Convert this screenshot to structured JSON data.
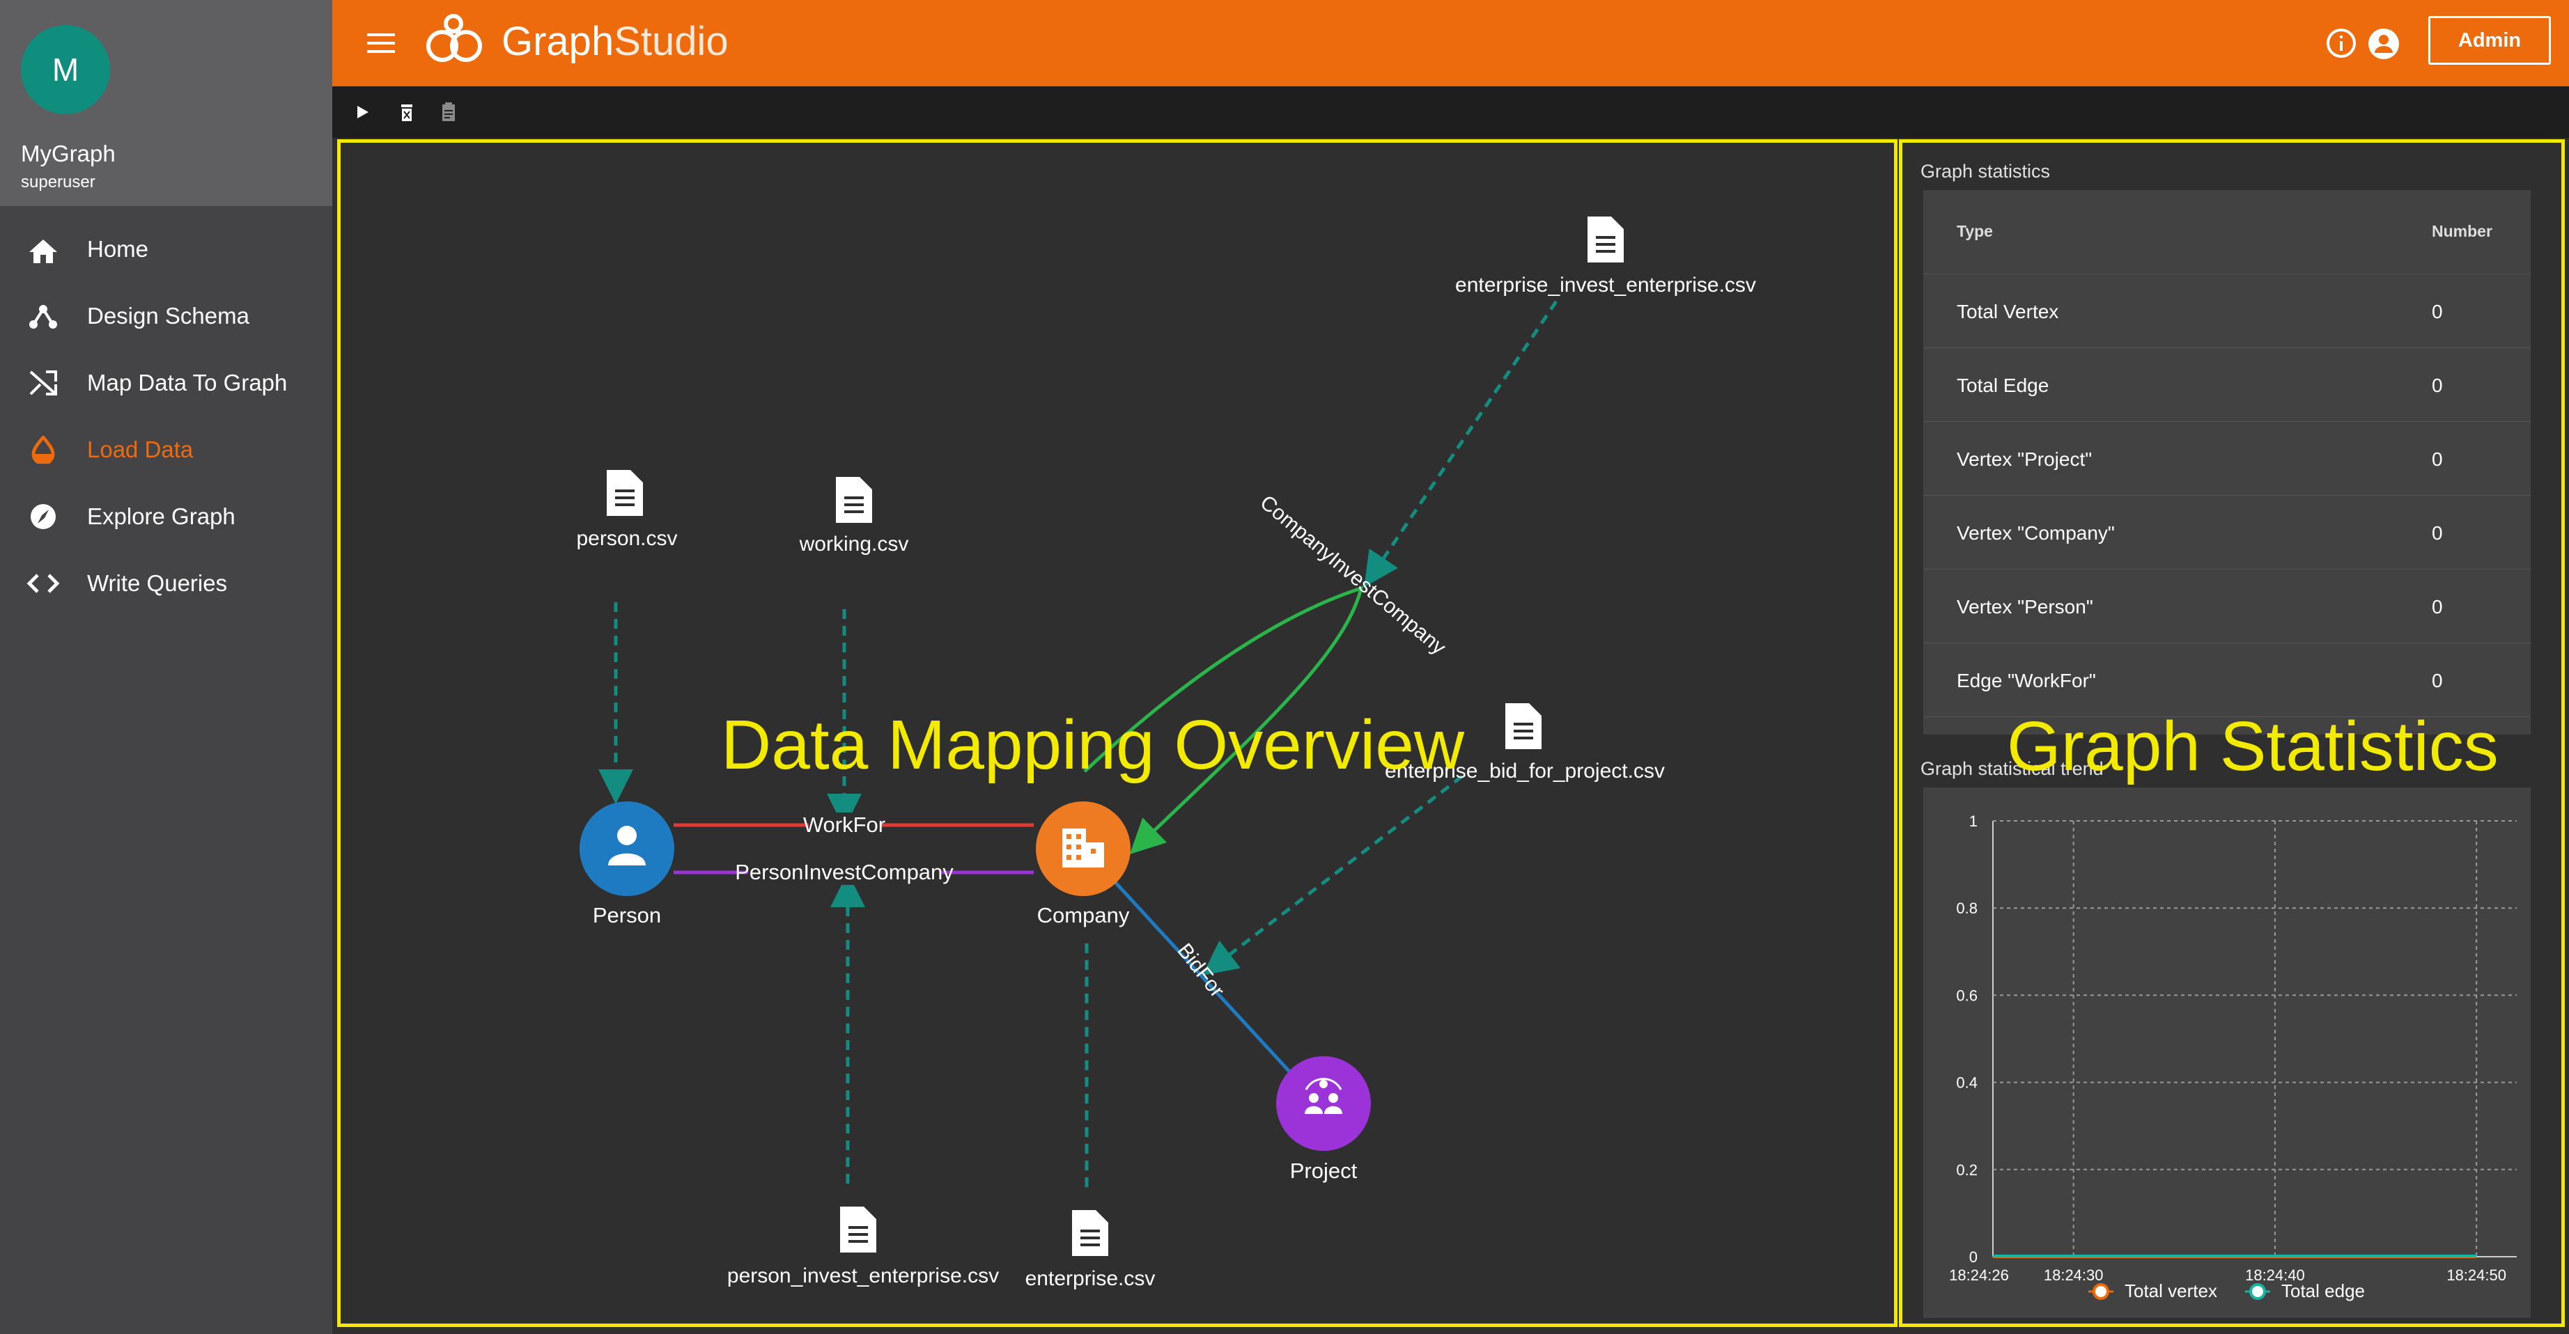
{
  "user": {
    "avatar_letter": "M",
    "name": "MyGraph",
    "role": "superuser"
  },
  "nav": [
    {
      "label": "Home",
      "icon": "home-icon",
      "active": false
    },
    {
      "label": "Design Schema",
      "icon": "schema-icon",
      "active": false
    },
    {
      "label": "Map Data To Graph",
      "icon": "shuffle-icon",
      "active": false
    },
    {
      "label": "Load Data",
      "icon": "drop-icon",
      "active": true
    },
    {
      "label": "Explore Graph",
      "icon": "compass-icon",
      "active": false
    },
    {
      "label": "Write Queries",
      "icon": "code-icon",
      "active": false
    }
  ],
  "header": {
    "title_part1": "Graph",
    "title_part2": "Studio",
    "admin_label": "Admin"
  },
  "colors": {
    "accent": "#ed6b0c",
    "highlight": "#f2ea00",
    "person": "#1f7bc1",
    "company": "#ee7b22",
    "project": "#9b33d9",
    "dashed": "#138d7f"
  },
  "overlays": {
    "overview": "Data Mapping Overview",
    "stats": "Graph Statistics"
  },
  "graph": {
    "vertices": [
      {
        "id": "person",
        "label": "Person"
      },
      {
        "id": "company",
        "label": "Company"
      },
      {
        "id": "project",
        "label": "Project"
      }
    ],
    "edges": [
      {
        "label": "WorkFor"
      },
      {
        "label": "PersonInvestCompany"
      },
      {
        "label": "CompanyInvestCompany"
      },
      {
        "label": "BidFor"
      }
    ],
    "files": [
      "person.csv",
      "working.csv",
      "enterprise_invest_enterprise.csv",
      "enterprise_bid_for_project.csv",
      "person_invest_enterprise.csv",
      "enterprise.csv"
    ]
  },
  "stats": {
    "title": "Graph statistics",
    "col_type": "Type",
    "col_number": "Number",
    "rows": [
      {
        "type": "Total Vertex",
        "number": "0"
      },
      {
        "type": "Total Edge",
        "number": "0"
      },
      {
        "type": "Vertex \"Project\"",
        "number": "0"
      },
      {
        "type": "Vertex \"Company\"",
        "number": "0"
      },
      {
        "type": "Vertex \"Person\"",
        "number": "0"
      },
      {
        "type": "Edge \"WorkFor\"",
        "number": "0"
      }
    ]
  },
  "trend": {
    "title": "Graph statistical trend"
  },
  "chart_data": {
    "type": "line",
    "title": "Graph statistical trend",
    "x": [
      "18:24:26",
      "18:24:30",
      "18:24:40",
      "18:24:50"
    ],
    "series": [
      {
        "name": "Total vertex",
        "values": [
          0,
          0,
          0,
          0
        ]
      },
      {
        "name": "Total edge",
        "values": [
          0,
          0,
          0,
          0
        ]
      }
    ],
    "ylim": [
      0,
      1
    ],
    "yticks": [
      "0",
      "0.2",
      "0.4",
      "0.6",
      "0.8",
      "1"
    ],
    "grid": true,
    "legend": "bottom"
  }
}
